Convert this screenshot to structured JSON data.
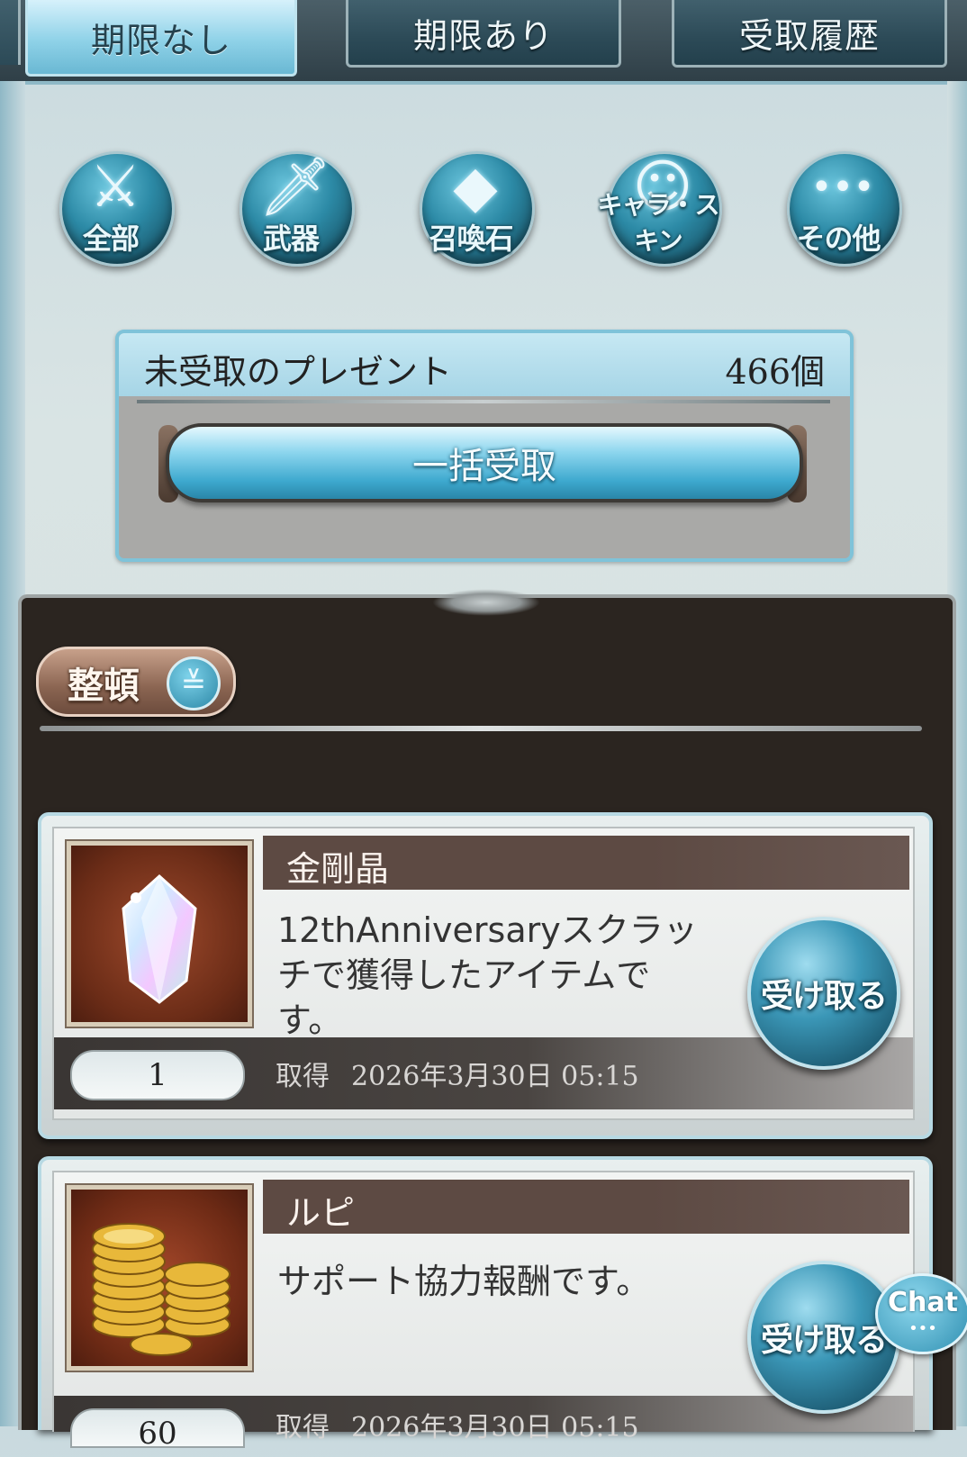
{
  "tabs": [
    {
      "label": "期限なし",
      "active": true
    },
    {
      "label": "期限あり",
      "active": false
    },
    {
      "label": "受取履歴",
      "active": false
    }
  ],
  "categories": [
    {
      "label": "全部",
      "icon": "all-items-icon",
      "glyph": "⚔"
    },
    {
      "label": "武器",
      "icon": "sword-icon",
      "glyph": "🗡"
    },
    {
      "label": "召喚石",
      "icon": "crystal-icon",
      "glyph": "◆"
    },
    {
      "label": "キャラ・スキン",
      "icon": "character-icon",
      "glyph": "☺"
    },
    {
      "label": "その他",
      "icon": "more-dots-icon",
      "glyph": "•••"
    }
  ],
  "present_summary": {
    "label": "未受取のプレゼント",
    "count": "466個",
    "bulk_button": "一括受取"
  },
  "sort": {
    "label": "整頓",
    "icon": "chevron-down-icon"
  },
  "presents": [
    {
      "name": "金剛晶",
      "description": "12thAnniversaryスクラッチで獲得したアイテムです。",
      "quantity": "1",
      "obtain_label": "取得",
      "obtain_date": "2026年3月30日 05:15",
      "button": "受け取る",
      "thumb_icon": "crystal-gem-icon"
    },
    {
      "name": "ルピ",
      "description": "サポート協力報酬です。",
      "quantity": "60",
      "obtain_label": "取得",
      "obtain_date": "2026年3月30日 05:15",
      "button": "受け取る",
      "thumb_icon": "gold-coins-icon"
    }
  ],
  "chat": {
    "label": "Chat",
    "dots": "•••"
  },
  "colors": {
    "accent": "#3ea9cf",
    "panel_dark": "#2b2520",
    "title_bar": "#5d4a43"
  }
}
